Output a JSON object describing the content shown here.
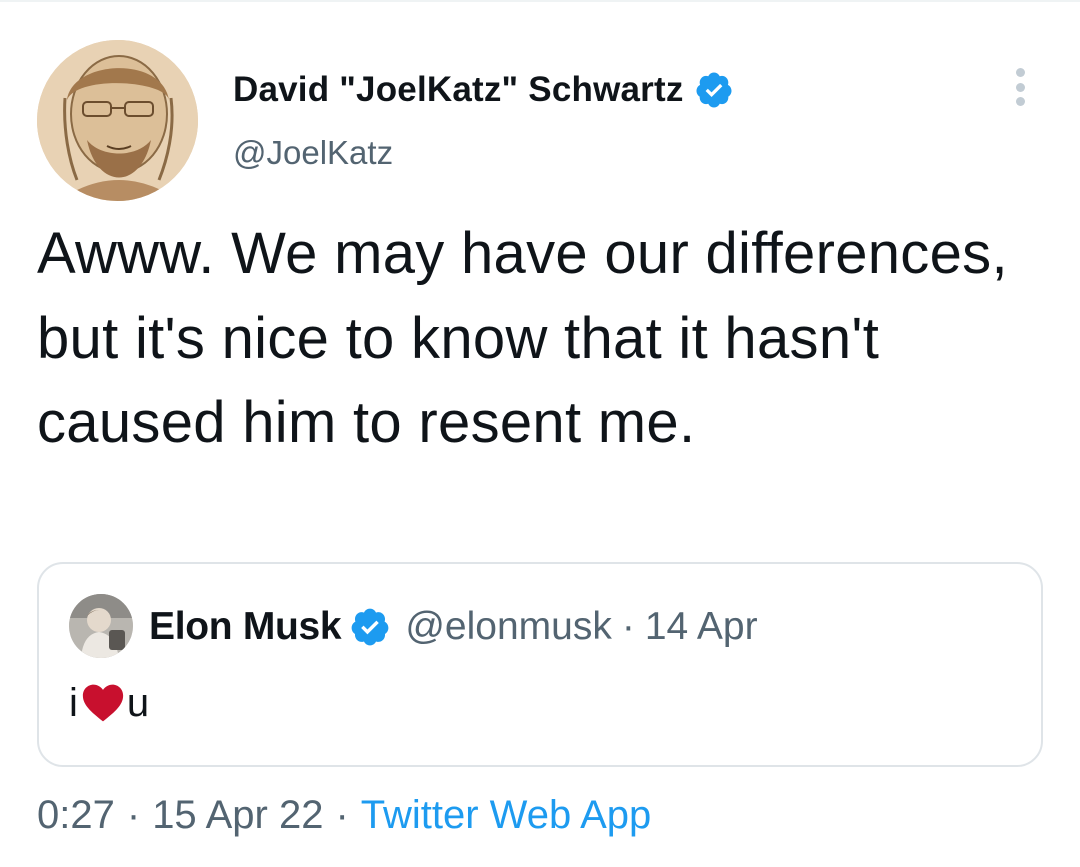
{
  "tweet": {
    "author": {
      "display_name": "David \"JoelKatz\" Schwartz",
      "handle": "@JoelKatz",
      "verified": true,
      "avatar_icon": "sketch-portrait-avatar"
    },
    "text": "Awww. We may have our differences, but it's nice to know that it hasn't caused him to resent me.",
    "more_icon": "more-vertical-icon",
    "quoted_tweet": {
      "author": {
        "display_name": "Elon Musk",
        "handle": "@elonmusk",
        "verified": true,
        "avatar_icon": "child-photo-avatar"
      },
      "separator": "·",
      "date": "14 Apr",
      "body_before": "i",
      "body_emoji": "heart-icon",
      "body_after": "u"
    },
    "meta": {
      "time": "0:27",
      "separator1": "·",
      "date": "15 Apr 22",
      "separator2": "·",
      "source": "Twitter Web App"
    }
  },
  "colors": {
    "text_primary": "#0f1419",
    "text_secondary": "#536471",
    "link": "#1d9bf0",
    "verified": "#1d9bf0",
    "heart": "#c8102e",
    "border": "#dfe4e8"
  }
}
